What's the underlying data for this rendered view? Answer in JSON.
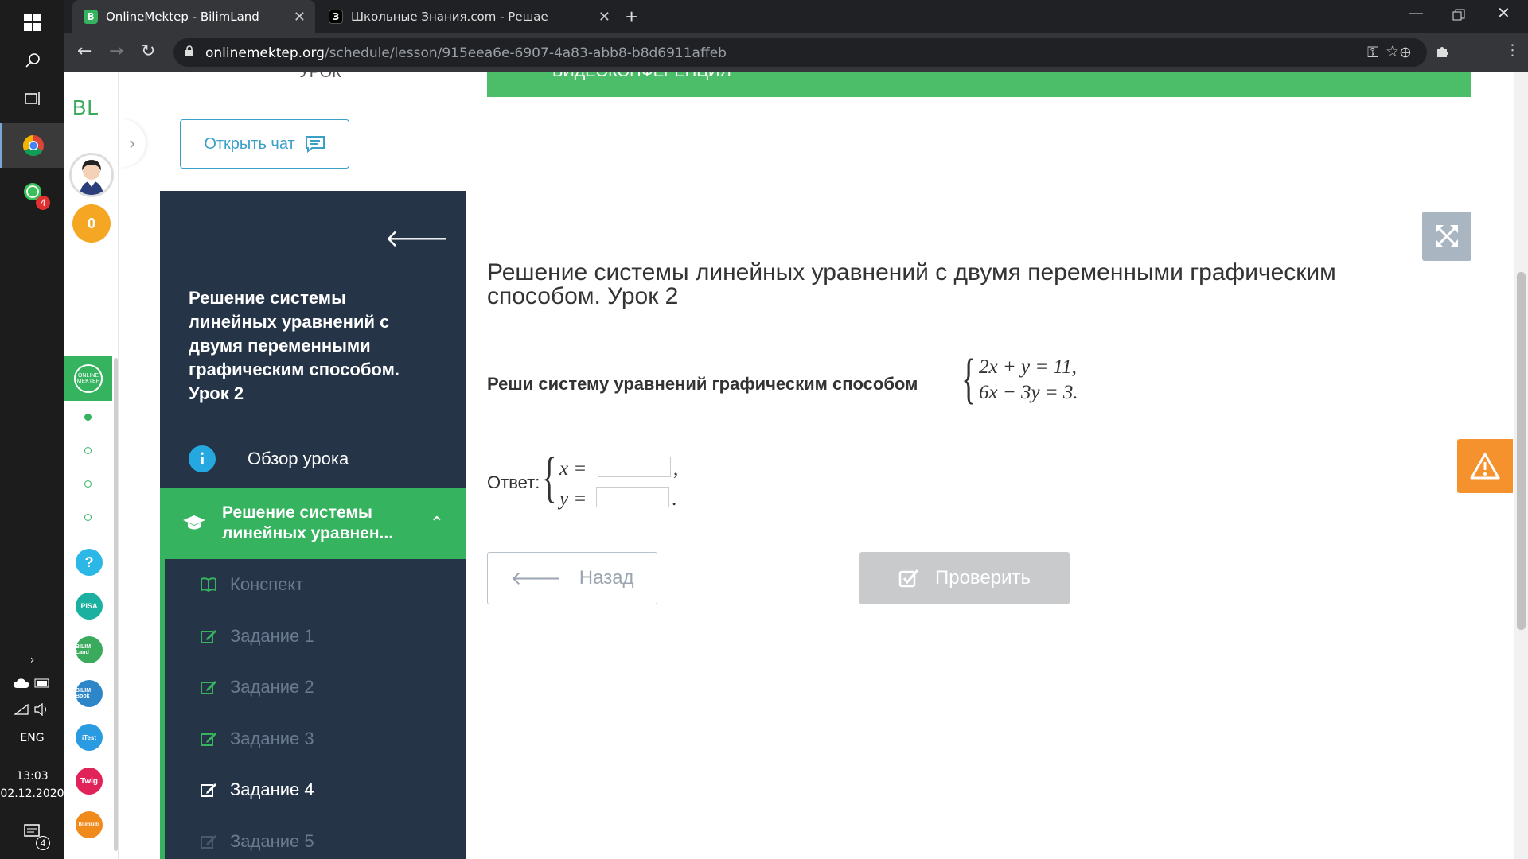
{
  "taskbar": {
    "language": "ENG",
    "time": "13:03",
    "date": "02.12.2020",
    "whatsapp_badge": "4",
    "notification_count": "4"
  },
  "browser": {
    "tabs": [
      {
        "title": "OnlineMektep - BilimLand",
        "favicon": "B",
        "active": true
      },
      {
        "title": "Школьные Знания.com - Решае",
        "favicon": "З",
        "active": false
      }
    ],
    "url_host": "onlinemektep.org",
    "url_path": "/schedule/lesson/915eea6e-6907-4a83-abb8-b8d6911affeb"
  },
  "rail": {
    "logo": "BL",
    "points": "0",
    "active_app_label": "ONLINE MEKTEP",
    "apps": [
      {
        "icon": "help-icon",
        "label": "?",
        "color": "#2bb8e6"
      },
      {
        "icon": "pisa-icon",
        "label": "PISA",
        "color": "#1bb0a0"
      },
      {
        "icon": "bilimland-icon",
        "label": "BILIM Land",
        "color": "#3aaa5c"
      },
      {
        "icon": "bilimbook-icon",
        "label": "BILIM Book",
        "color": "#2d86c8"
      },
      {
        "icon": "itest-icon",
        "label": "iTest",
        "color": "#2a9be0"
      },
      {
        "icon": "twig-icon",
        "label": "Twig",
        "color": "#e0245a"
      },
      {
        "icon": "bilimkids-icon",
        "label": "Bilimkids",
        "color": "#f08a1c"
      }
    ]
  },
  "header": {
    "section_label": "УРОК",
    "banner_text": "ВИДЕОКОНФЕРЕНЦИЯ",
    "open_chat": "Открыть чат"
  },
  "sidebar": {
    "lesson_title": "Решение системы линейных уравнений с двумя переменными графическим способом. Урок 2",
    "overview": "Обзор урока",
    "current": "Решение системы линейных уравнен...",
    "items": [
      {
        "label": "Конспект",
        "icon": "book-icon",
        "active": false
      },
      {
        "label": "Задание 1",
        "icon": "edit-icon",
        "active": false
      },
      {
        "label": "Задание 2",
        "icon": "edit-icon",
        "active": false
      },
      {
        "label": "Задание 3",
        "icon": "edit-icon",
        "active": false
      },
      {
        "label": "Задание 4",
        "icon": "edit-icon",
        "active": true
      },
      {
        "label": "Задание 5",
        "icon": "edit-icon",
        "active": false
      }
    ]
  },
  "task": {
    "title": "Решение системы линейных уравнений с двумя переменными графическим способом. Урок 2",
    "prompt": "Реши систему уравнений графическим способом",
    "equation1": "2x + y = 11,",
    "equation2": "6x − 3y = 3.",
    "answer_label": "Ответ:",
    "x_label": "x =",
    "y_label": "y =",
    "x_value": "",
    "y_value": "",
    "x_suffix": ",",
    "y_suffix": "."
  },
  "buttons": {
    "back": "Назад",
    "check": "Проверить"
  },
  "colors": {
    "accent_green": "#35b35f",
    "panel_dark": "#253447",
    "warning_orange": "#f5922e"
  }
}
